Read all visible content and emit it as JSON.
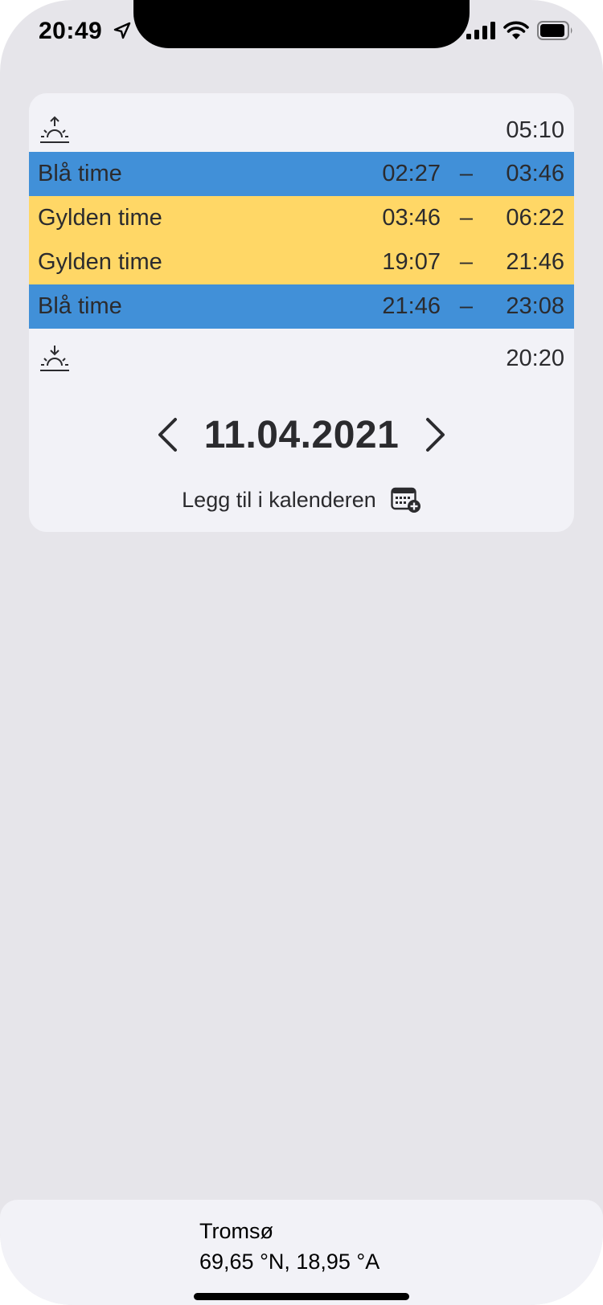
{
  "status_bar": {
    "time": "20:49",
    "icons": [
      "location-arrow-icon",
      "signal-icon",
      "wifi-icon",
      "battery-icon"
    ]
  },
  "card": {
    "sunrise": {
      "icon": "sunrise-icon",
      "time": "05:10"
    },
    "periods": [
      {
        "label": "Blå time",
        "from": "02:27",
        "dash": "–",
        "to": "03:46",
        "kind": "blue"
      },
      {
        "label": "Gylden time",
        "from": "03:46",
        "dash": "–",
        "to": "06:22",
        "kind": "golden"
      },
      {
        "label": "Gylden time",
        "from": "19:07",
        "dash": "–",
        "to": "21:46",
        "kind": "golden"
      },
      {
        "label": "Blå time",
        "from": "21:46",
        "dash": "–",
        "to": "23:08",
        "kind": "blue"
      }
    ],
    "sunset": {
      "icon": "sunset-icon",
      "time": "20:20"
    },
    "date": "11.04.2021",
    "add_to_calendar": "Legg til i kalenderen"
  },
  "location": {
    "city": "Tromsø",
    "coordinates": "69,65 °N, 18,95 °A"
  },
  "colors": {
    "blue_hour": "#4190d8",
    "golden_hour": "#ffd766",
    "background": "#e6e5ea",
    "card": "#f2f2f7"
  }
}
